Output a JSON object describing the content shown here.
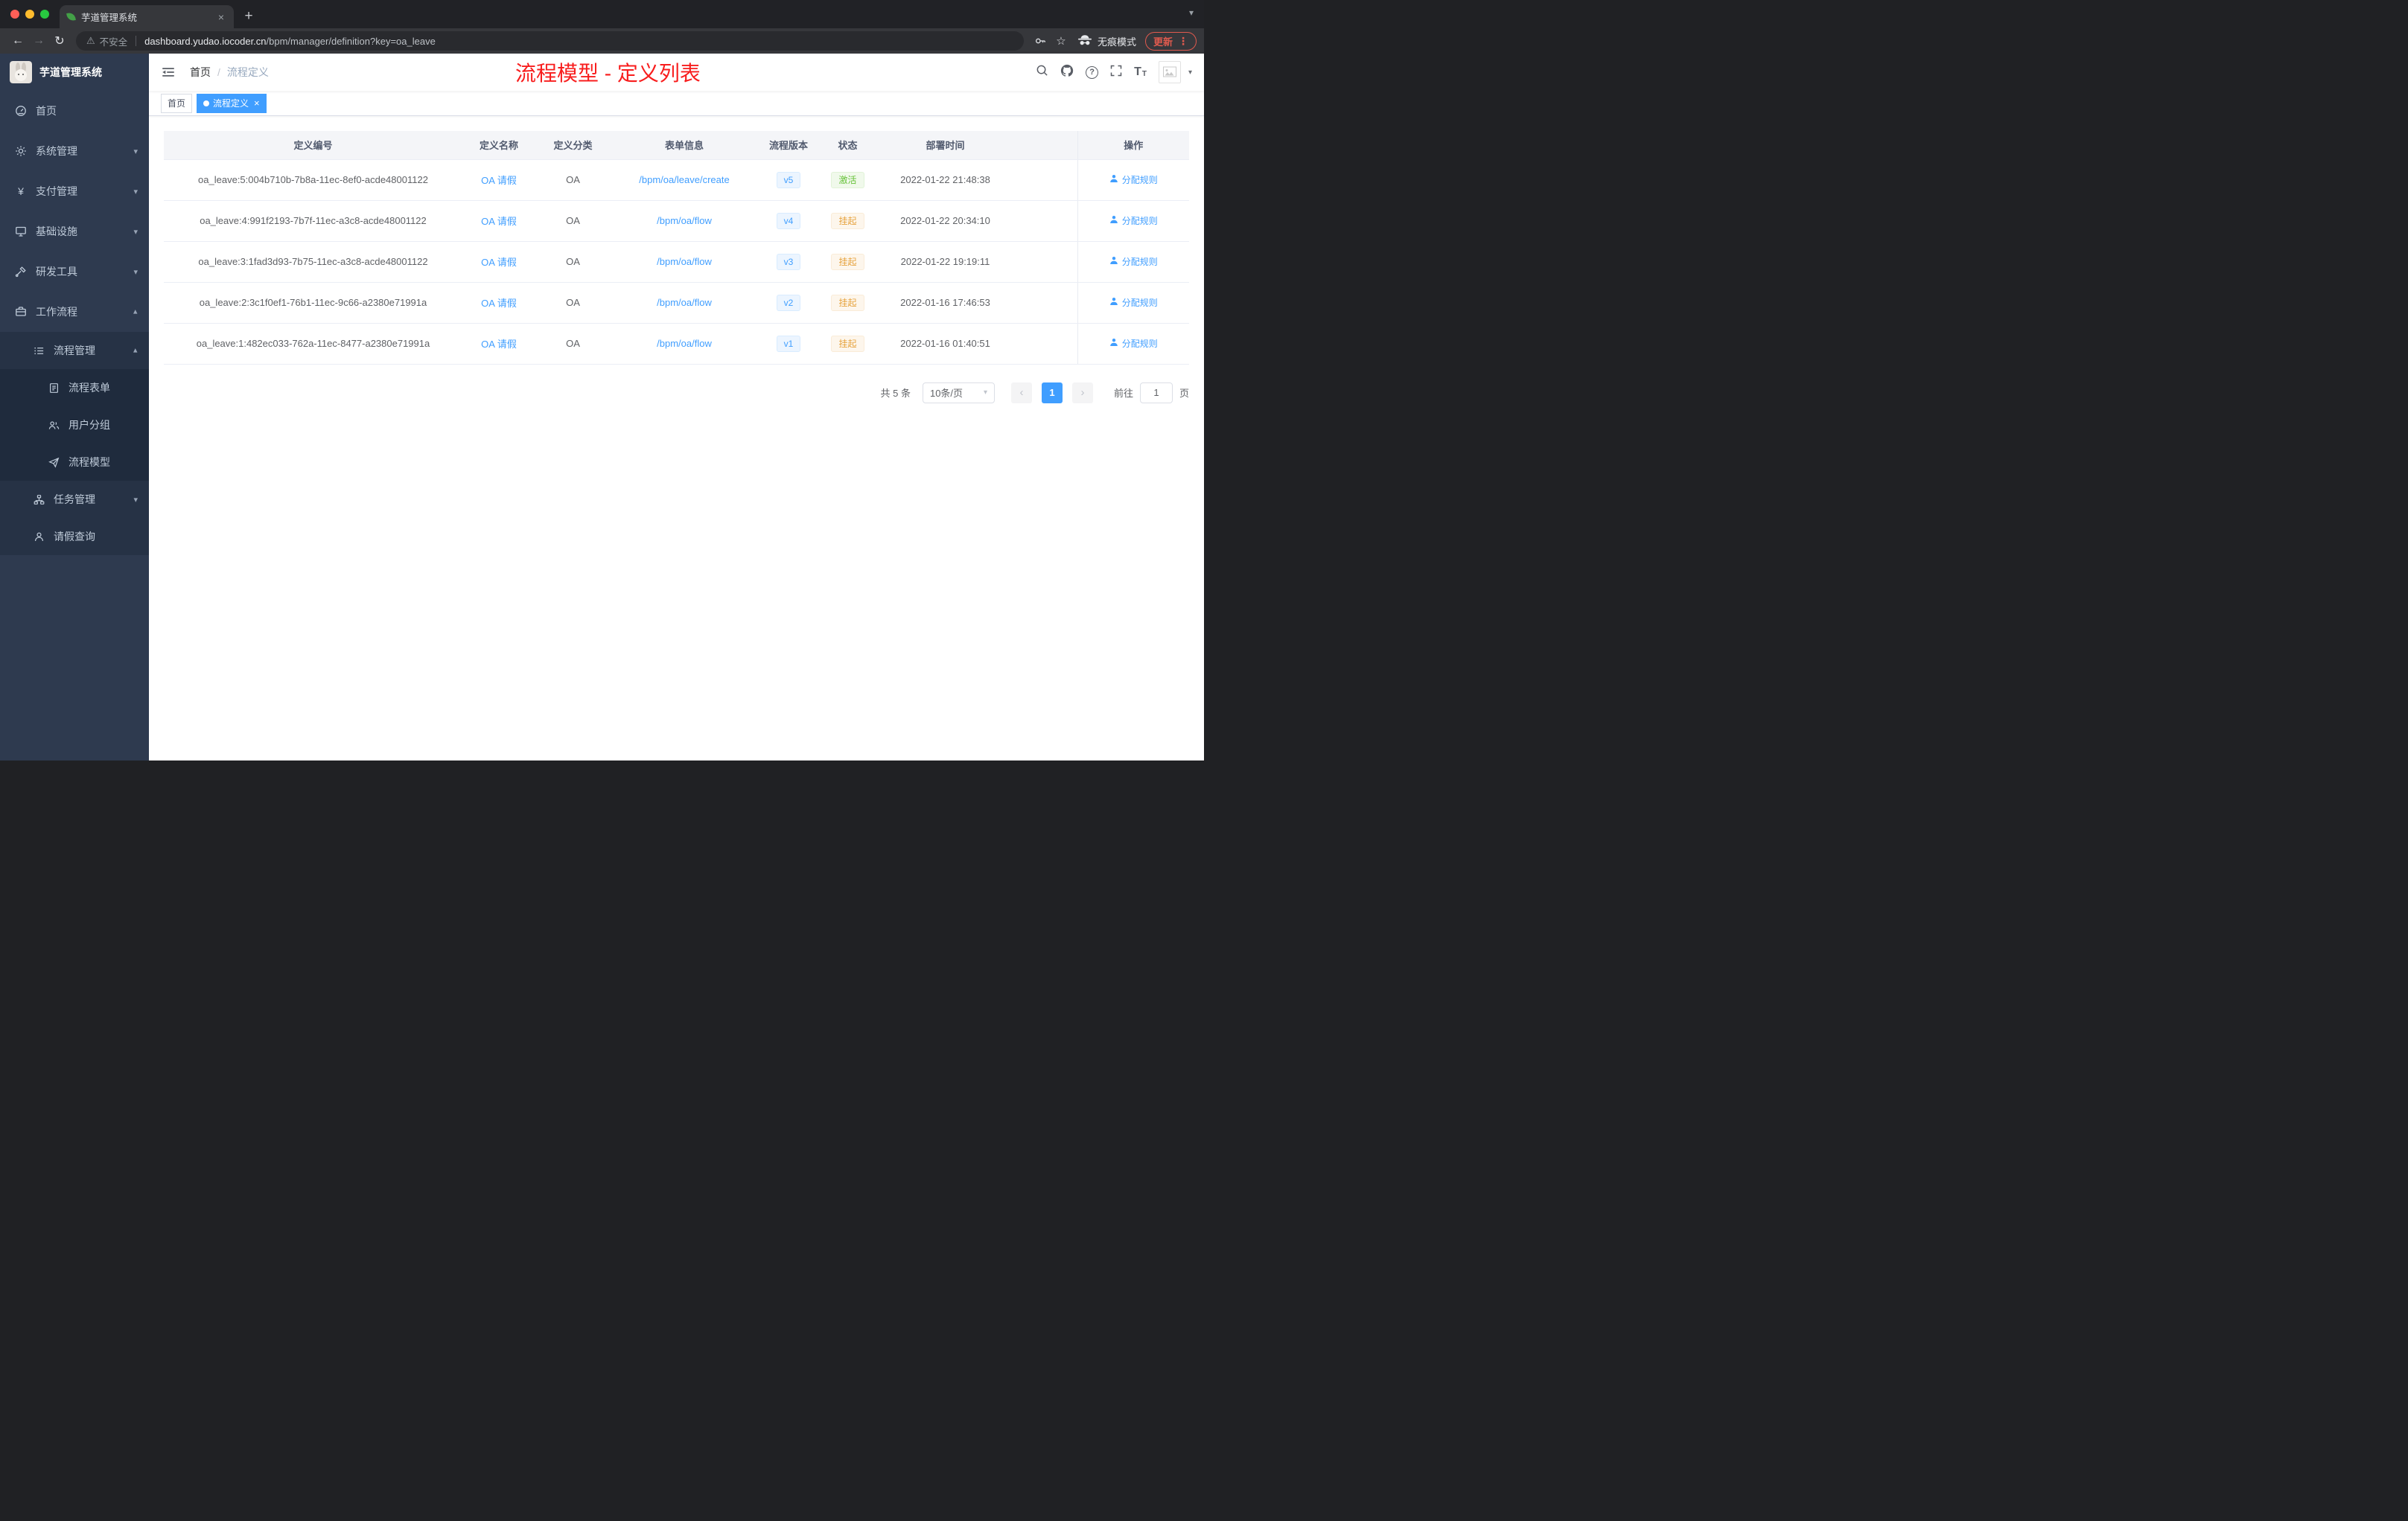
{
  "colors": {
    "accent": "#409eff",
    "sidebar_bg": "#2e3a4f",
    "sidebar_submenu_bg": "#1f2b3d",
    "annotation_red": "#f81d1d",
    "status_success_text": "#67c23a",
    "status_success_bg": "#f0f9eb",
    "status_warning_text": "#e6a23c",
    "status_warning_bg": "#fdf6ec",
    "version_text": "#409eff",
    "version_bg": "#ecf5ff",
    "table_header_bg": "#f4f5f8",
    "update_red": "#e05a4e"
  },
  "glyphs": {
    "close": "×",
    "plus": "+",
    "chevron_down": "▾",
    "back": "←",
    "forward": "→",
    "refresh": "↻",
    "warning": "⚠",
    "star": "☆",
    "dots": "⋮",
    "yen": "¥",
    "question": "?",
    "font_large": "T",
    "font_small": "T",
    "breadcrumb_sep": "/",
    "prev": "‹",
    "next": "›"
  },
  "browser": {
    "tab_title": "芋道管理系统",
    "security_label": "不安全",
    "url_domain": "dashboard.yudao.iocoder.cn",
    "url_path": "/bpm/manager/definition?key=oa_leave",
    "incognito_label": "无痕模式",
    "update_label": "更新"
  },
  "sidebar": {
    "logo_title": "芋道管理系统",
    "menu": [
      {
        "label": "首页"
      },
      {
        "label": "系统管理"
      },
      {
        "label": "支付管理"
      },
      {
        "label": "基础设施"
      },
      {
        "label": "研发工具"
      },
      {
        "label": "工作流程"
      }
    ],
    "sub": {
      "process_mgmt": "流程管理",
      "children": [
        {
          "label": "流程表单"
        },
        {
          "label": "用户分组"
        },
        {
          "label": "流程模型"
        }
      ],
      "task_mgmt": "任务管理",
      "leave_query": "请假查询"
    }
  },
  "header": {
    "breadcrumb_home": "首页",
    "breadcrumb_current": "流程定义",
    "annotation": "流程模型 - 定义列表"
  },
  "tags": {
    "home": "首页",
    "active": "流程定义"
  },
  "table": {
    "columns": [
      "定义编号",
      "定义名称",
      "定义分类",
      "表单信息",
      "流程版本",
      "状态",
      "部署时间",
      "操作"
    ],
    "rows": [
      {
        "id": "oa_leave:5:004b710b-7b8a-11ec-8ef0-acde48001122",
        "name": "OA 请假",
        "category": "OA",
        "form": "/bpm/oa/leave/create",
        "version": "v5",
        "status": "激活",
        "status_type": "success",
        "time": "2022-01-22 21:48:38",
        "action": "分配规则"
      },
      {
        "id": "oa_leave:4:991f2193-7b7f-11ec-a3c8-acde48001122",
        "name": "OA 请假",
        "category": "OA",
        "form": "/bpm/oa/flow",
        "version": "v4",
        "status": "挂起",
        "status_type": "warning",
        "time": "2022-01-22 20:34:10",
        "action": "分配规则"
      },
      {
        "id": "oa_leave:3:1fad3d93-7b75-11ec-a3c8-acde48001122",
        "name": "OA 请假",
        "category": "OA",
        "form": "/bpm/oa/flow",
        "version": "v3",
        "status": "挂起",
        "status_type": "warning",
        "time": "2022-01-22 19:19:11",
        "action": "分配规则"
      },
      {
        "id": "oa_leave:2:3c1f0ef1-76b1-11ec-9c66-a2380e71991a",
        "name": "OA 请假",
        "category": "OA",
        "form": "/bpm/oa/flow",
        "version": "v2",
        "status": "挂起",
        "status_type": "warning",
        "time": "2022-01-16 17:46:53",
        "action": "分配规则"
      },
      {
        "id": "oa_leave:1:482ec033-762a-11ec-8477-a2380e71991a",
        "name": "OA 请假",
        "category": "OA",
        "form": "/bpm/oa/flow",
        "version": "v1",
        "status": "挂起",
        "status_type": "warning",
        "time": "2022-01-16 01:40:51",
        "action": "分配规则"
      }
    ]
  },
  "pagination": {
    "total": "共 5 条",
    "page_size": "10条/页",
    "page": "1",
    "goto_label": "前往",
    "goto_value": "1",
    "unit": "页"
  }
}
